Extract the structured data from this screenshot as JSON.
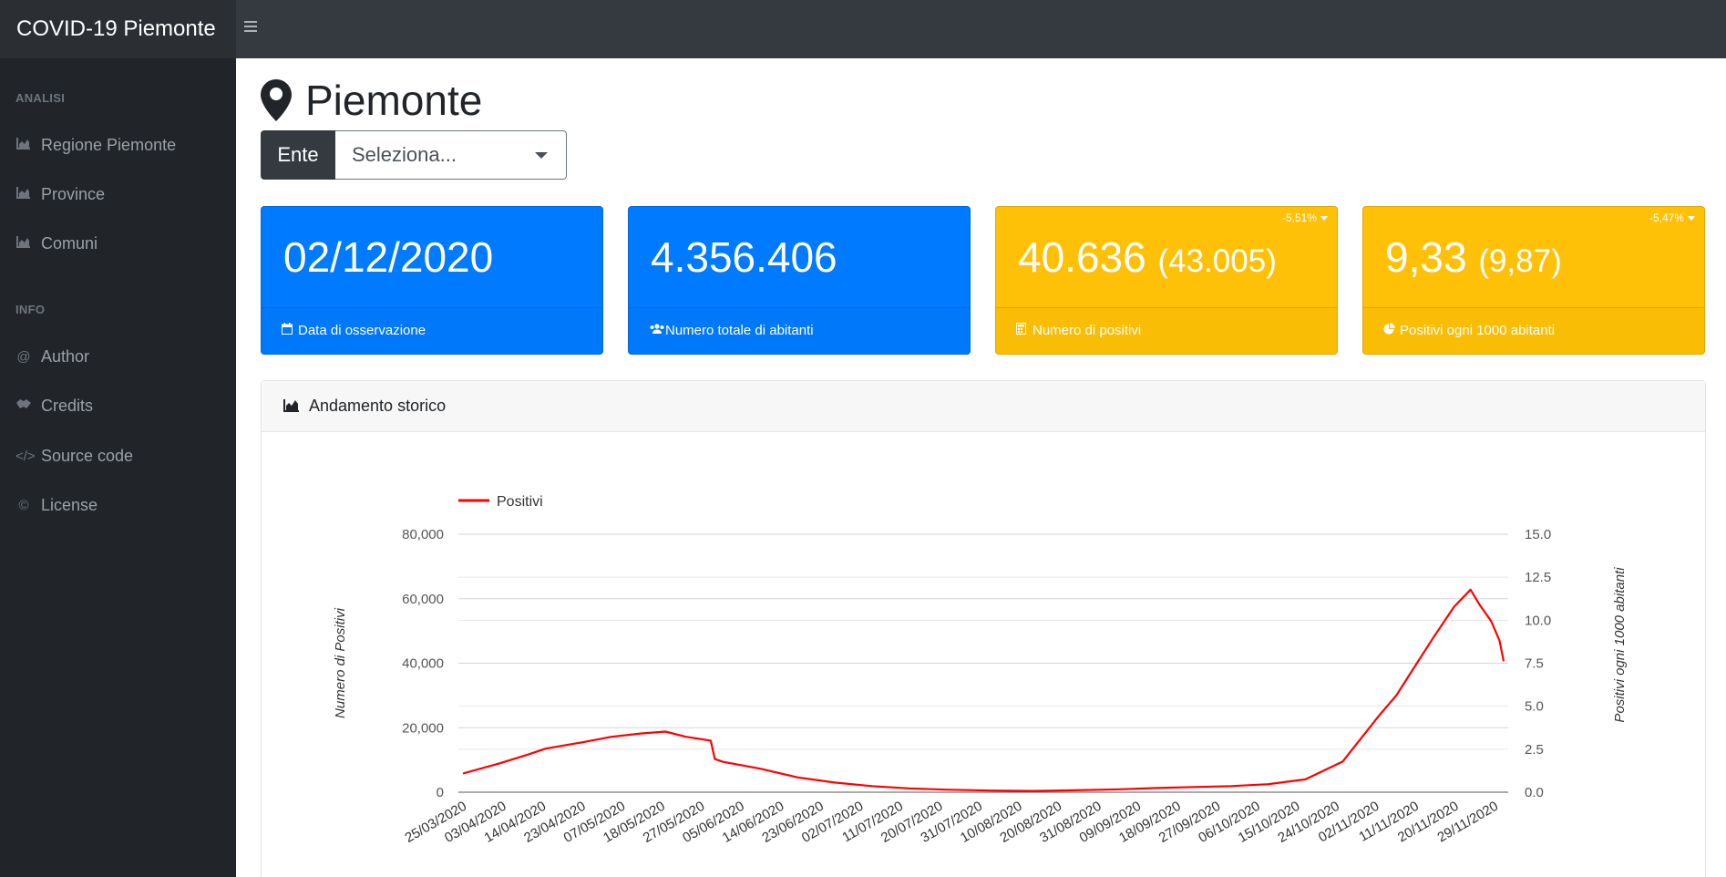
{
  "app": {
    "brand": "COVID-19 Piemonte"
  },
  "sidebar": {
    "sections": [
      {
        "heading": "ANALISI",
        "items": [
          {
            "label": "Regione Piemonte",
            "icon": "chart-area-icon"
          },
          {
            "label": "Province",
            "icon": "chart-area-icon"
          },
          {
            "label": "Comuni",
            "icon": "chart-area-icon"
          }
        ]
      },
      {
        "heading": "INFO",
        "items": [
          {
            "label": "Author",
            "icon": "at-icon"
          },
          {
            "label": "Credits",
            "icon": "handshake-icon"
          },
          {
            "label": "Source code",
            "icon": "code-icon"
          },
          {
            "label": "License",
            "icon": "copyright-icon"
          }
        ]
      }
    ]
  },
  "main": {
    "title": "Piemonte",
    "select": {
      "label": "Ente",
      "value": "Seleziona..."
    },
    "cards": [
      {
        "value": "02/12/2020",
        "footer": "Data di osservazione",
        "color": "#007bff",
        "icon": "calendar-icon"
      },
      {
        "value": "4.356.406",
        "footer": "Numero totale di abitanti",
        "color": "#007bff",
        "icon": "users-icon"
      },
      {
        "value": "40.636",
        "previous": "(43.005)",
        "delta": "-5,51%",
        "footer": "Numero di positivi",
        "color": "#ffc107",
        "icon": "calculator-icon"
      },
      {
        "value": "9,33",
        "previous": "(9,87)",
        "delta": "-5,47%",
        "footer": "Positivi ogni 1000 abitanti",
        "color": "#ffc107",
        "icon": "pie-chart-icon"
      }
    ],
    "panel_title": "Andamento storico"
  },
  "chart_data": {
    "type": "line",
    "title": "",
    "xlabel": "",
    "ylabel": "Numero di Positivi",
    "y2label": "Positivi ogni 1000 abitanti",
    "ylim": [
      0,
      80000
    ],
    "y2lim": [
      0,
      15
    ],
    "yticks": [
      "0",
      "20,000",
      "40,000",
      "60,000",
      "80,000"
    ],
    "y2ticks": [
      "0.0",
      "2.5",
      "5.0",
      "7.5",
      "10.0",
      "12.5",
      "15.0"
    ],
    "grid": true,
    "legend_position": "top-left",
    "x_tick_labels": [
      "25/03/2020",
      "03/04/2020",
      "14/04/2020",
      "23/04/2020",
      "07/05/2020",
      "18/05/2020",
      "27/05/2020",
      "05/06/2020",
      "14/06/2020",
      "23/06/2020",
      "02/07/2020",
      "11/07/2020",
      "20/07/2020",
      "31/07/2020",
      "10/08/2020",
      "20/08/2020",
      "31/08/2020",
      "09/09/2020",
      "18/09/2020",
      "27/09/2020",
      "06/10/2020",
      "15/10/2020",
      "24/10/2020",
      "02/11/2020",
      "11/11/2020",
      "20/11/2020",
      "29/11/2020"
    ],
    "series": [
      {
        "name": "Positivi",
        "color": "#ff0000",
        "points": [
          [
            "25/03/2020",
            5800
          ],
          [
            "03/04/2020",
            9000
          ],
          [
            "10/04/2020",
            11800
          ],
          [
            "14/04/2020",
            13500
          ],
          [
            "23/04/2020",
            15500
          ],
          [
            "30/04/2020",
            17200
          ],
          [
            "07/05/2020",
            18200
          ],
          [
            "13/05/2020",
            18800
          ],
          [
            "18/05/2020",
            17200
          ],
          [
            "24/05/2020",
            16000
          ],
          [
            "25/05/2020",
            10300
          ],
          [
            "27/05/2020",
            9400
          ],
          [
            "05/06/2020",
            7300
          ],
          [
            "14/06/2020",
            4600
          ],
          [
            "23/06/2020",
            3000
          ],
          [
            "02/07/2020",
            1900
          ],
          [
            "11/07/2020",
            1200
          ],
          [
            "20/07/2020",
            800
          ],
          [
            "31/07/2020",
            500
          ],
          [
            "10/08/2020",
            400
          ],
          [
            "20/08/2020",
            600
          ],
          [
            "31/08/2020",
            900
          ],
          [
            "09/09/2020",
            1300
          ],
          [
            "18/09/2020",
            1600
          ],
          [
            "27/09/2020",
            1900
          ],
          [
            "06/10/2020",
            2500
          ],
          [
            "15/10/2020",
            4000
          ],
          [
            "24/10/2020",
            9500
          ],
          [
            "02/11/2020",
            24000
          ],
          [
            "06/11/2020",
            30000
          ],
          [
            "11/11/2020",
            40000
          ],
          [
            "15/11/2020",
            48000
          ],
          [
            "20/11/2020",
            57500
          ],
          [
            "24/11/2020",
            62800
          ],
          [
            "26/11/2020",
            58500
          ],
          [
            "29/11/2020",
            53000
          ],
          [
            "01/12/2020",
            47000
          ],
          [
            "02/12/2020",
            40636
          ]
        ]
      }
    ]
  }
}
